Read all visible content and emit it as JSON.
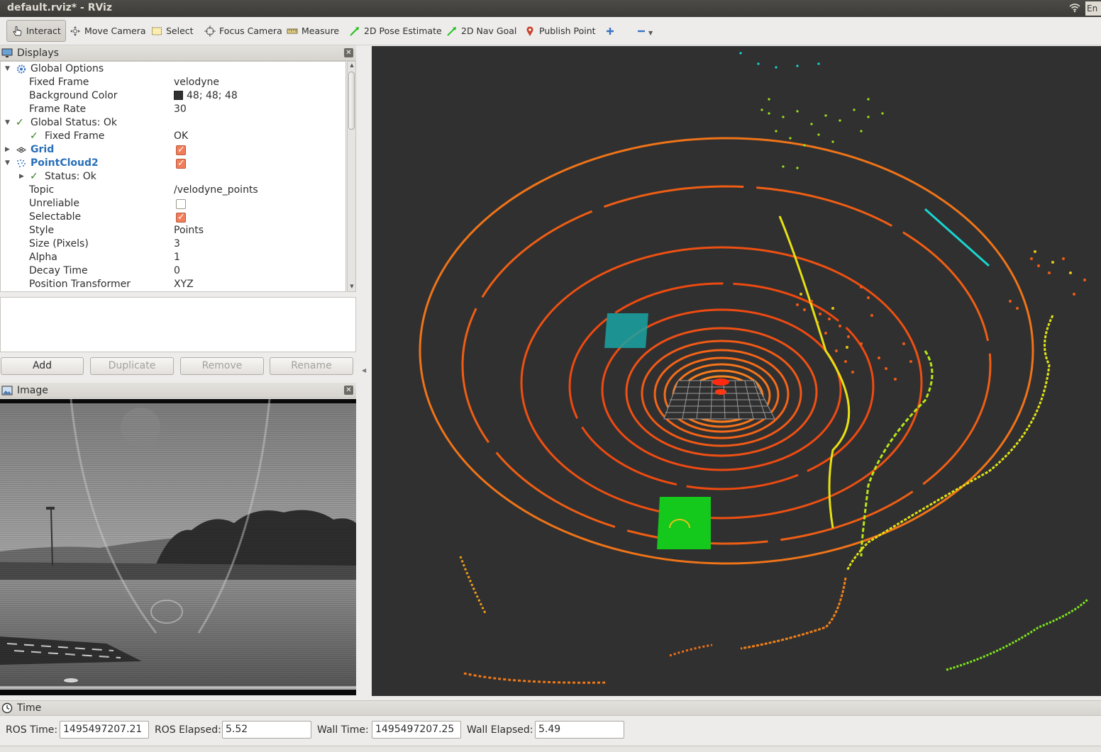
{
  "window": {
    "title": "default.rviz* - RViz",
    "keyboard_indicator": "En"
  },
  "toolbar": {
    "tools": [
      {
        "label": "Interact",
        "icon": "hand-pointer-icon",
        "active": true
      },
      {
        "label": "Move Camera",
        "icon": "move-camera-icon"
      },
      {
        "label": "Select",
        "icon": "select-rect-icon"
      },
      {
        "label": "Focus Camera",
        "icon": "focus-camera-icon"
      },
      {
        "label": "Measure",
        "icon": "ruler-icon"
      },
      {
        "label": "2D Pose Estimate",
        "icon": "green-arrow-icon"
      },
      {
        "label": "2D Nav Goal",
        "icon": "green-arrow-icon"
      },
      {
        "label": "Publish Point",
        "icon": "map-pin-icon"
      }
    ],
    "extra_icons": [
      "add-tool-plus-icon",
      "remove-tool-minus-icon",
      "dropdown-arrow-icon"
    ]
  },
  "displays_panel": {
    "title": "Displays",
    "rows": [
      {
        "label": "Global Options",
        "value": ""
      },
      {
        "label": "Fixed Frame",
        "value": "velodyne"
      },
      {
        "label": "Background Color",
        "value": "48; 48; 48"
      },
      {
        "label": "Frame Rate",
        "value": "30"
      },
      {
        "label": "Global Status: Ok",
        "value": ""
      },
      {
        "label": "Fixed Frame",
        "value": "OK"
      },
      {
        "label": "Grid",
        "value": "",
        "checked": true
      },
      {
        "label": "PointCloud2",
        "value": "",
        "checked": true
      },
      {
        "label": "Status: Ok",
        "value": ""
      },
      {
        "label": "Topic",
        "value": "/velodyne_points"
      },
      {
        "label": "Unreliable",
        "value": "",
        "checked": false
      },
      {
        "label": "Selectable",
        "value": "",
        "checked": true
      },
      {
        "label": "Style",
        "value": "Points"
      },
      {
        "label": "Size (Pixels)",
        "value": "3"
      },
      {
        "label": "Alpha",
        "value": "1"
      },
      {
        "label": "Decay Time",
        "value": "0"
      },
      {
        "label": "Position Transformer",
        "value": "XYZ"
      }
    ],
    "background_color_hex": "#303030",
    "buttons": {
      "add": "Add",
      "duplicate": "Duplicate",
      "remove": "Remove",
      "rename": "Rename"
    }
  },
  "image_panel": {
    "title": "Image"
  },
  "time_panel": {
    "title": "Time",
    "ros_time_label": "ROS Time:",
    "ros_time": "1495497207.21",
    "ros_elapsed_label": "ROS Elapsed:",
    "ros_elapsed": "5.52",
    "wall_time_label": "Wall Time:",
    "wall_time": "1495497207.25",
    "wall_elapsed_label": "Wall Elapsed:",
    "wall_elapsed": "5.49"
  },
  "colors": {
    "accent_blue": "#2a6fb8",
    "ok_green": "#2d7d1c",
    "checkbox_orange": "#f27d5a",
    "viewport_bg": "#303030"
  }
}
